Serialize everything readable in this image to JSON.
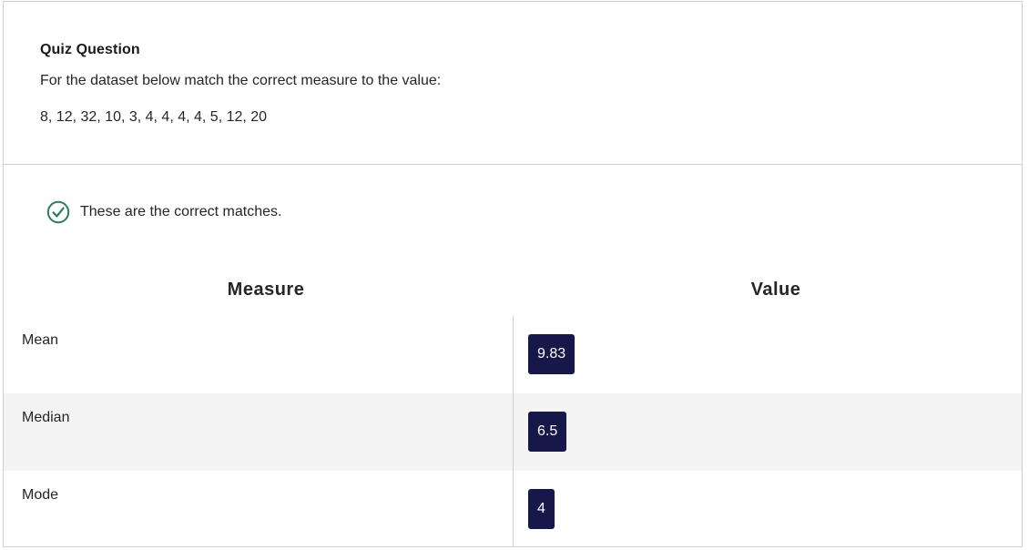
{
  "question": {
    "title": "Quiz Question",
    "prompt": "For the dataset below match the correct measure to the value:",
    "dataset": "8, 12, 32, 10, 3, 4, 4, 4, 4, 5, 12, 20"
  },
  "feedback": {
    "icon": "check-circle-icon",
    "icon_color": "#2e7d57",
    "text": "These are the correct matches."
  },
  "table": {
    "headers": {
      "measure": "Measure",
      "value": "Value"
    },
    "rows": [
      {
        "measure": "Mean",
        "value": "9.83"
      },
      {
        "measure": "Median",
        "value": "6.5"
      },
      {
        "measure": "Mode",
        "value": "4"
      }
    ]
  },
  "colors": {
    "chip_bg": "#17174a",
    "alt_row_bg": "#f4f4f4",
    "border": "#cfcfcf"
  }
}
